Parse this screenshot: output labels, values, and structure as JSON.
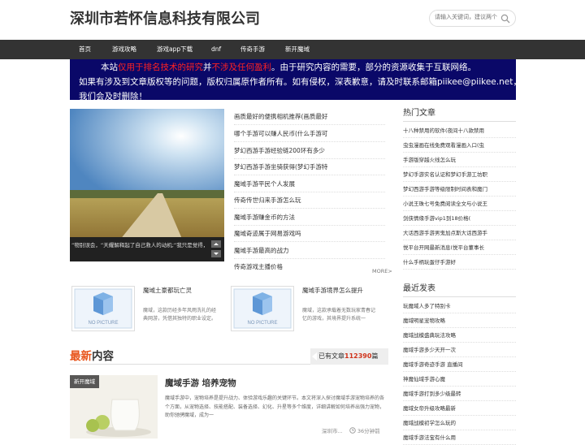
{
  "site": {
    "title": "深圳市若怀信息科技有限公司"
  },
  "search": {
    "placeholder": "请输入关键词，建议两个"
  },
  "nav": {
    "items": [
      "首页",
      "游戏攻略",
      "游戏app下载",
      "dnf",
      "传奇手游",
      "新开魔域"
    ]
  },
  "notice": {
    "l1_a": "本站",
    "l1_b": "仅用于排名技术的研究",
    "l1_c": "并",
    "l1_d": "不涉及任何盈利",
    "l1_e": "。由于研究内容的需要，部分的资源收集于互联网络。",
    "line2": "如果有涉及到文章版权等的问题，版权归属原作者所有。如有侵权，深表歉意，请及时联系邮箱piikee@piikee.net，",
    "line3": "我们会及时删除！"
  },
  "slider": {
    "caption": "“物别误会，“天耀解释起了自己救人的动机;“我只是觉得，"
  },
  "toplist": {
    "items": [
      "画质最好的便携相机推荐(画质最好",
      "哪个手游可以赚人民币(什么手游可",
      "梦幻西游手游经验链200环有多少",
      "梦幻西游手游坐骑获得(梦幻手游特",
      "魔域手游平民个人发展",
      "传奇传世归来手游怎么玩",
      "魔域手游赚金币的方法",
      "魔域奇迹属于网易游戏吗",
      "魔域手游最高的战力",
      "传奇游戏主播价格"
    ],
    "more": "MORE>"
  },
  "cards": [
    {
      "title": "魔域土豪都玩亡灵",
      "desc": "魔域，这款历经多年风雨洗礼的经典网游，凭借其独特的职业设定。",
      "no_picture": "NO PICTURE"
    },
    {
      "title": "魔域手游境界怎么提升",
      "desc": "魔域，这款承载着无数玩家青春记忆的游戏，其境界提升系统一",
      "no_picture": "NO PICTURE"
    }
  ],
  "latest": {
    "title_a": "最新",
    "title_b": "内容",
    "count_prefix": "已有文章",
    "count": "112390",
    "count_suffix": "篇"
  },
  "article": {
    "tag": "新开魔域",
    "title": "魔域手游 培养宠物",
    "desc": "魔域手游中，宠物培养是提升战力、体验游戏乐趣的关键环节。本文将深入探讨魔域手游宠物培养的各个方面，从宠物选择、技能搭配、装备选择、幻化、升星等多个维度，详细讲解如何培养出强力宠物，助你驰骋魔域，成为一",
    "source": "深圳市...",
    "time": "36分钟前"
  },
  "sidebar": {
    "hot_title": "热门文章",
    "hot": [
      "十八种禁用的软件(夜间十八款禁用",
      "虫虫漫画在线免费观看漫画入口(虫",
      "手游版穿越火线怎么玩",
      "梦幻手游实名认证和梦幻手游工坊职",
      "梦幻西游手游等级限制时间表和魔门",
      "小说王珠七号免费阅读全文与小说王",
      "剑侠情缘手游vip1到18价格(",
      "大话西游手游男鬼加点斯大话西游手",
      "悦平台开网最新消息(悦平台董事长",
      "什么手柄玩蛋仔手游好"
    ],
    "recent_title": "最近发表",
    "recent": [
      "玩魔域人多了特别卡",
      "魔域明星宠物攻略",
      "魔域战模盛典玩法攻略",
      "魔域手游多少天开一次",
      "魔域手游奇迹手游 直播间",
      "神魔仙域手游心魔",
      "魔域手游打到多少级最转",
      "魔域女帝升级攻略最新",
      "魔域战模初学怎么玩的",
      "魔域手游法宝有什么用"
    ]
  },
  "colors": {
    "nav_bg": "#333333",
    "notice_bg": "#0a0868",
    "accent_red": "#e8541b"
  }
}
